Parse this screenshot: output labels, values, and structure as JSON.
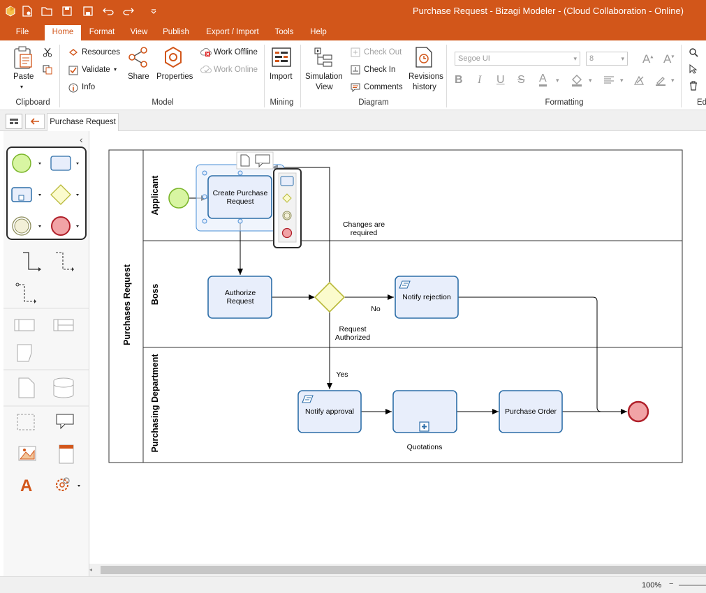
{
  "window": {
    "title": "Purchase Request - Bizagi Modeler - (Cloud Collaboration - Online)"
  },
  "menu_tabs": [
    {
      "label": "File"
    },
    {
      "label": "Home"
    },
    {
      "label": "Format"
    },
    {
      "label": "View"
    },
    {
      "label": "Publish"
    },
    {
      "label": "Export / Import"
    },
    {
      "label": "Tools"
    },
    {
      "label": "Help"
    }
  ],
  "ribbon": {
    "clipboard": {
      "label": "Clipboard",
      "paste": "Paste"
    },
    "model": {
      "label": "Model",
      "resources": "Resources",
      "validate": "Validate",
      "info": "Info",
      "share": "Share",
      "properties": "Properties",
      "work_offline": "Work Offline",
      "work_online": "Work Online"
    },
    "mining": {
      "label": "Mining",
      "import": "Import"
    },
    "diagram": {
      "label": "Diagram",
      "simulation_line1": "Simulation",
      "simulation_line2": "View",
      "check_out": "Check Out",
      "check_in": "Check In",
      "comments": "Comments",
      "revisions_line1": "Revisions",
      "revisions_line2": "history"
    },
    "formatting": {
      "label": "Formatting",
      "font_name": "Segoe UI",
      "font_size": "8"
    },
    "editing": {
      "label": "Ed"
    }
  },
  "document_tab": {
    "label": "Purchase Request"
  },
  "diagram": {
    "pool": "Purchases Request",
    "lanes": [
      "Applicant",
      "Boss",
      "Purchasing Department"
    ],
    "tasks": {
      "create": [
        "Create Purchase",
        "Request"
      ],
      "authorize": [
        "Authorize",
        "Request"
      ],
      "notify_rejection": "Notify rejection",
      "notify_approval": "Notify approval",
      "quotations": "Quotations",
      "purchase_order": "Purchase Order"
    },
    "flow_labels": {
      "changes": [
        "Changes are",
        "required"
      ],
      "no": "No",
      "authorized": [
        "Request",
        "Authorized"
      ],
      "yes": "Yes"
    }
  },
  "status": {
    "zoom": "100%"
  },
  "colors": {
    "accent": "#d2561a",
    "task_fill": "#e8eefb",
    "task_stroke": "#2d6ea8",
    "start_fill": "#d8f5a2",
    "start_stroke": "#7ab52a",
    "end_fill": "#f1a3a6",
    "end_stroke": "#b0202a",
    "gateway_fill": "#fbfbcd",
    "gateway_stroke": "#b9b93a"
  }
}
